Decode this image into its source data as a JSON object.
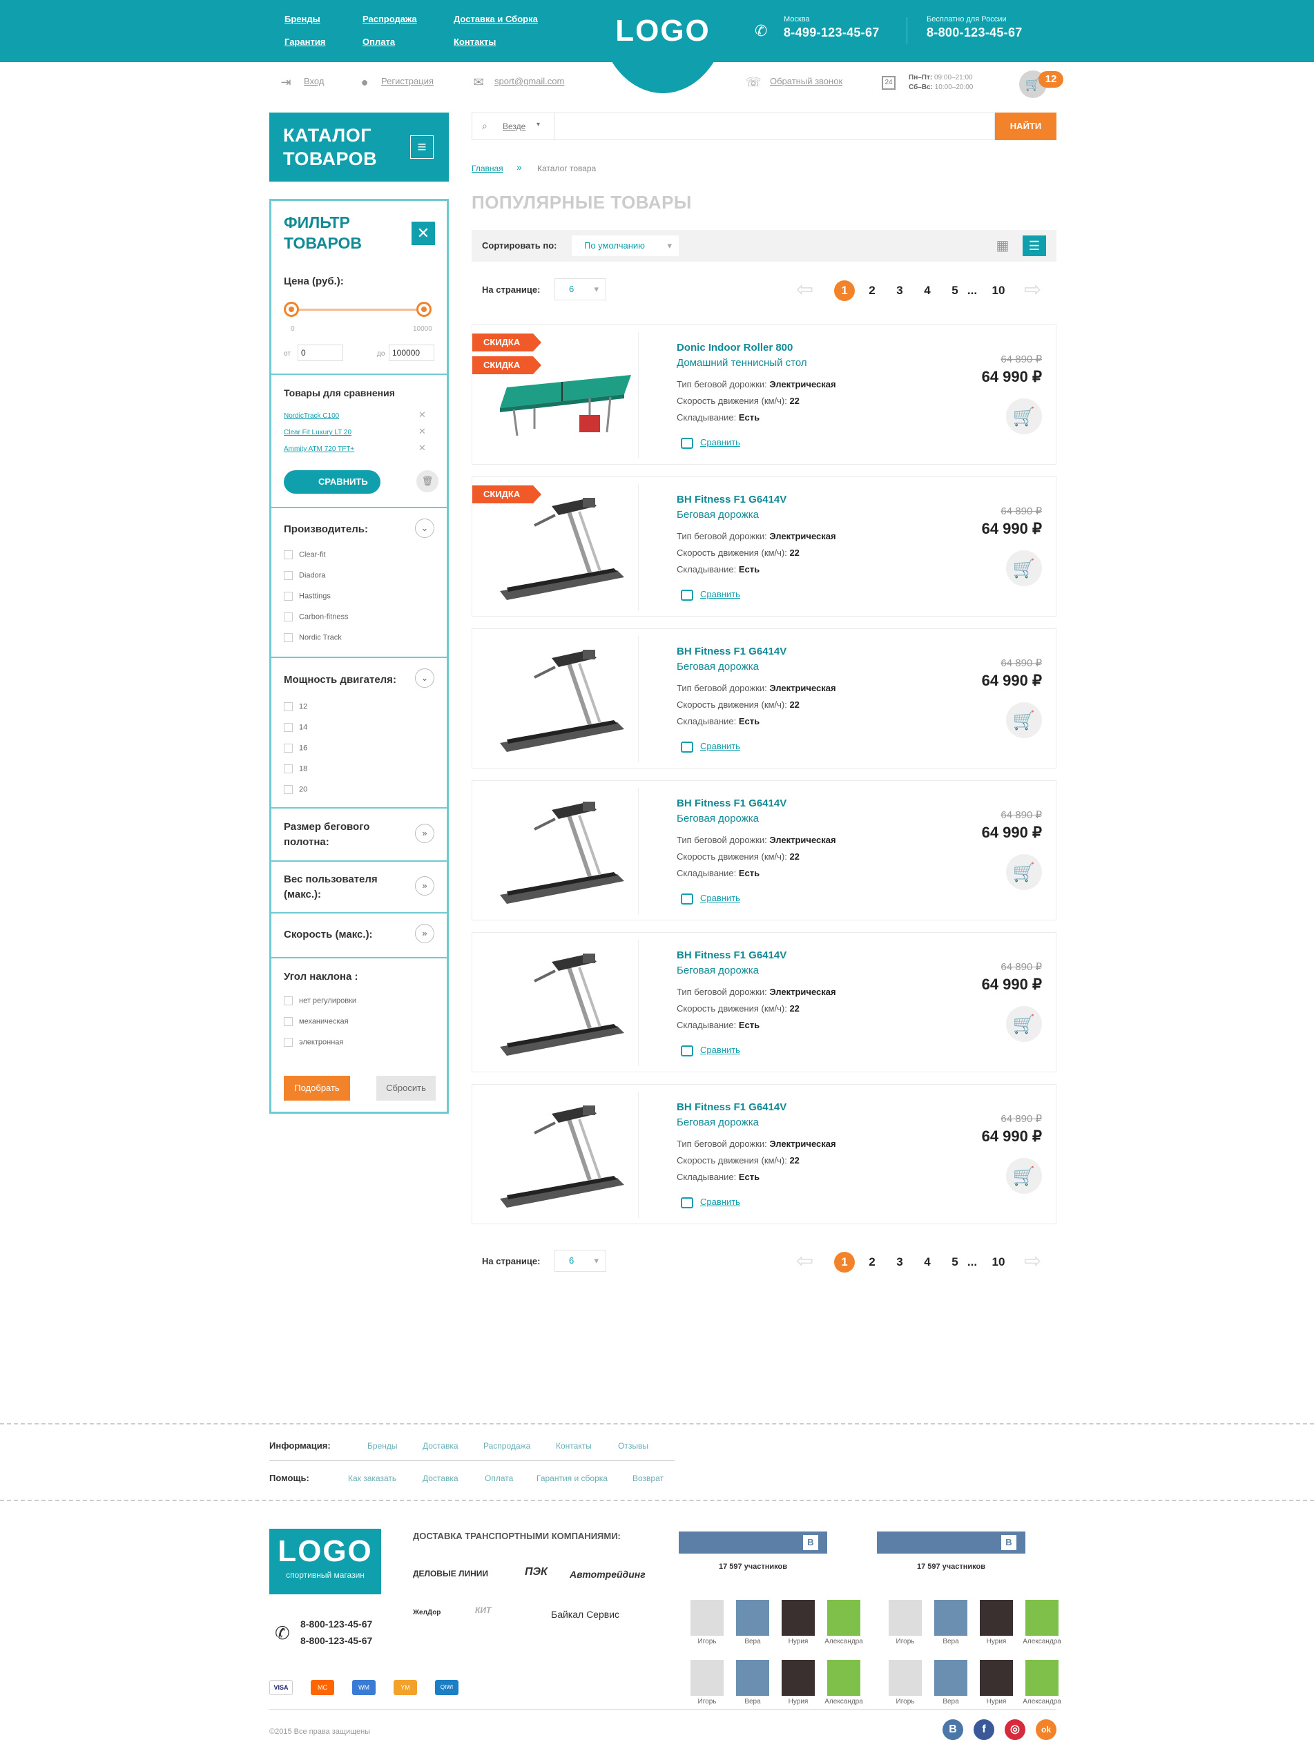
{
  "header": {
    "nav": [
      "Бренды",
      "Распродажа",
      "Доставка и Сборка",
      "Гарантия",
      "Оплата",
      "Контакты"
    ],
    "logo": "LOGO",
    "phone1": {
      "city": "Москва",
      "number": "8-499-123-45-67"
    },
    "phone2": {
      "city": "Бесплатно для России",
      "number": "8-800-123-45-67"
    }
  },
  "subbar": {
    "login": "Вход",
    "register": "Регистрация",
    "email": "sport@gmail.com",
    "callback": "Обратный звонок",
    "hours_weekday_label": "Пн–Пт:",
    "hours_weekday": "09:00–21:00",
    "hours_weekend_label": "Сб–Вс:",
    "hours_weekend": "10:00–20:00",
    "calendar_day": "24",
    "cart_count": "12"
  },
  "catalog": {
    "title_line1": "КАТАЛОГ",
    "title_line2": "ТОВАРОВ"
  },
  "search": {
    "scope": "Везде",
    "button": "НАЙТИ"
  },
  "breadcrumb": {
    "home": "Главная",
    "current": "Каталог товара"
  },
  "page_title": "ПОПУЛЯРНЫЕ ТОВАРЫ",
  "sort": {
    "label": "Сортировать по:",
    "value": "По умолчанию"
  },
  "pager": {
    "label": "На странице:",
    "per_page": "6",
    "pages": [
      "1",
      "2",
      "3",
      "4",
      "5",
      "...",
      "10"
    ]
  },
  "filter": {
    "title_line1": "ФИЛЬТР",
    "title_line2": "ТОВАРОВ",
    "price_label": "Цена (руб.):",
    "min": "0",
    "max": "10000",
    "from_label": "от",
    "to_label": "до",
    "from_value": "0",
    "to_value": "100000",
    "compare_title": "Товары для сравнения",
    "compare_items": [
      "NordicTrack C100",
      "Clear Fit Luxury LT 20",
      "Ammity ATM 720 TFT+"
    ],
    "compare_button": "СРАВНИТЬ",
    "manufacturer_title": "Производитель:",
    "manufacturers": [
      "Clear-fit",
      "Diadora",
      "Hasttings",
      "Carbon-fitness",
      "Nordic Track"
    ],
    "power_title": "Мощность двигателя:",
    "powers": [
      "12",
      "14",
      "16",
      "18",
      "20"
    ],
    "belt_title_1": "Размер бегового",
    "belt_title_2": "полотна:",
    "weight_title_1": "Вес пользователя",
    "weight_title_2": "(макс.):",
    "speed_title": "Скорость (макс.):",
    "incline_title": "Угол наклона :",
    "inclines": [
      "нет регулировки",
      "механическая",
      "электронная"
    ],
    "apply": "Подобрать",
    "reset": "Сбросить"
  },
  "products": [
    {
      "title": "Donic Indoor Roller 800",
      "subtitle": "Домашний теннисный стол",
      "badges": [
        "СКИДКА",
        "СКИДКА"
      ],
      "type_label": "Тип беговой дорожки:",
      "type": "Электрическая",
      "speed_label": "Скорость движения (км/ч):",
      "speed": "22",
      "fold_label": "Складывание:",
      "fold": "Есть",
      "compare": "Сравнить",
      "old_price": "64 890 ₽",
      "price": "64 990 ₽"
    },
    {
      "title": "BH Fitness F1 G6414V",
      "subtitle": "Беговая дорожка",
      "badges": [
        "СКИДКА"
      ],
      "type_label": "Тип беговой дорожки:",
      "type": "Электрическая",
      "speed_label": "Скорость движения (км/ч):",
      "speed": "22",
      "fold_label": "Складывание:",
      "fold": "Есть",
      "compare": "Сравнить",
      "old_price": "64 890 ₽",
      "price": "64 990 ₽"
    },
    {
      "title": "BH Fitness F1 G6414V",
      "subtitle": "Беговая дорожка",
      "badges": [],
      "type_label": "Тип беговой дорожки:",
      "type": "Электрическая",
      "speed_label": "Скорость движения (км/ч):",
      "speed": "22",
      "fold_label": "Складывание:",
      "fold": "Есть",
      "compare": "Сравнить",
      "old_price": "64 890 ₽",
      "price": "64 990 ₽"
    },
    {
      "title": "BH Fitness F1 G6414V",
      "subtitle": "Беговая дорожка",
      "badges": [],
      "type_label": "Тип беговой дорожки:",
      "type": "Электрическая",
      "speed_label": "Скорость движения (км/ч):",
      "speed": "22",
      "fold_label": "Складывание:",
      "fold": "Есть",
      "compare": "Сравнить",
      "old_price": "64 890 ₽",
      "price": "64 990 ₽"
    },
    {
      "title": "BH Fitness F1 G6414V",
      "subtitle": "Беговая дорожка",
      "badges": [],
      "type_label": "Тип беговой дорожки:",
      "type": "Электрическая",
      "speed_label": "Скорость движения (км/ч):",
      "speed": "22",
      "fold_label": "Складывание:",
      "fold": "Есть",
      "compare": "Сравнить",
      "old_price": "64 890 ₽",
      "price": "64 990 ₽"
    },
    {
      "title": "BH Fitness F1 G6414V",
      "subtitle": "Беговая дорожка",
      "badges": [],
      "type_label": "Тип беговой дорожки:",
      "type": "Электрическая",
      "speed_label": "Скорость движения (км/ч):",
      "speed": "22",
      "fold_label": "Складывание:",
      "fold": "Есть",
      "compare": "Сравнить",
      "old_price": "64 890 ₽",
      "price": "64 990 ₽"
    }
  ],
  "footer": {
    "info_label": "Информация:",
    "info_links": [
      "Бренды",
      "Доставка",
      "Распродажа",
      "Контакты",
      "Отзывы"
    ],
    "help_label": "Помощь:",
    "help_links": [
      "Как заказать",
      "Доставка",
      "Оплата",
      "Гарантия и сборка",
      "Возврат"
    ],
    "logo": "LOGO",
    "logo_sub": "спортивный магазин",
    "phones": [
      "8-800-123-45-67",
      "8-800-123-45-67"
    ],
    "delivery_title": "ДОСТАВКА ТРАНСПОРТНЫМИ КОМПАНИЯМИ:",
    "carriers": [
      "ДЕЛОВЫЕ ЛИНИИ",
      "ПЭК",
      "Автотрейдинг",
      "ЖелДор",
      "КИТ",
      "Байкал Сервис"
    ],
    "vk_members": "17 597 участников",
    "vk_letter": "B",
    "vk_people": [
      "Игорь",
      "Вера",
      "Нурия",
      "Александра",
      "Игорь",
      "Вера",
      "Нурия",
      "Александра"
    ],
    "payments": [
      "VISA",
      "MC",
      "WM",
      "YM",
      "QIWI"
    ],
    "copyright": "©2015 Все права защищены",
    "social": [
      "B",
      "f",
      "◎",
      "ok"
    ],
    "colors": {
      "teal": "#10a0ad",
      "orange": "#f2832b",
      "red": "#f05a28"
    }
  }
}
